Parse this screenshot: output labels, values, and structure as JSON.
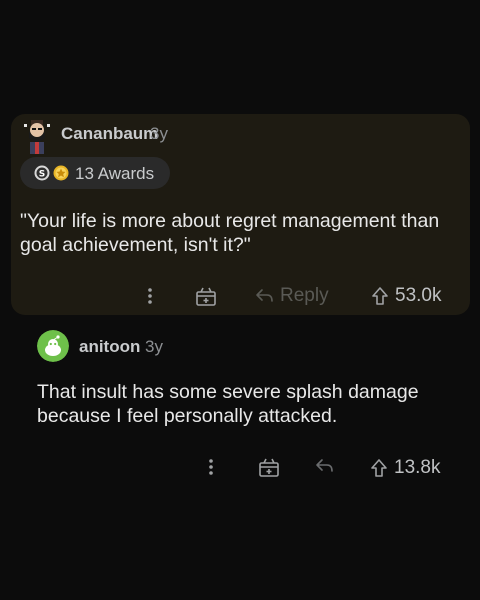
{
  "comments": [
    {
      "username": "Cananbaum",
      "age": "3y",
      "awards_label": "13 Awards",
      "text": "\"Your life is more about regret management than goal achievement, isn't it?\"",
      "reply_label": "Reply",
      "votes": "53.0k",
      "avatar_icon": "bearded-character-avatar",
      "award_icons": [
        "silver-award-icon",
        "gold-award-icon"
      ]
    },
    {
      "username": "anitoon",
      "age": "3y",
      "text": "That insult has some severe splash damage because I feel personally attacked.",
      "votes": "13.8k",
      "avatar_icon": "green-snoo-avatar"
    }
  ],
  "colors": {
    "background": "#0c0c0c",
    "highlight_card": "#1e1b12",
    "text": "#e8e8e8",
    "muted": "#8c8f92"
  }
}
